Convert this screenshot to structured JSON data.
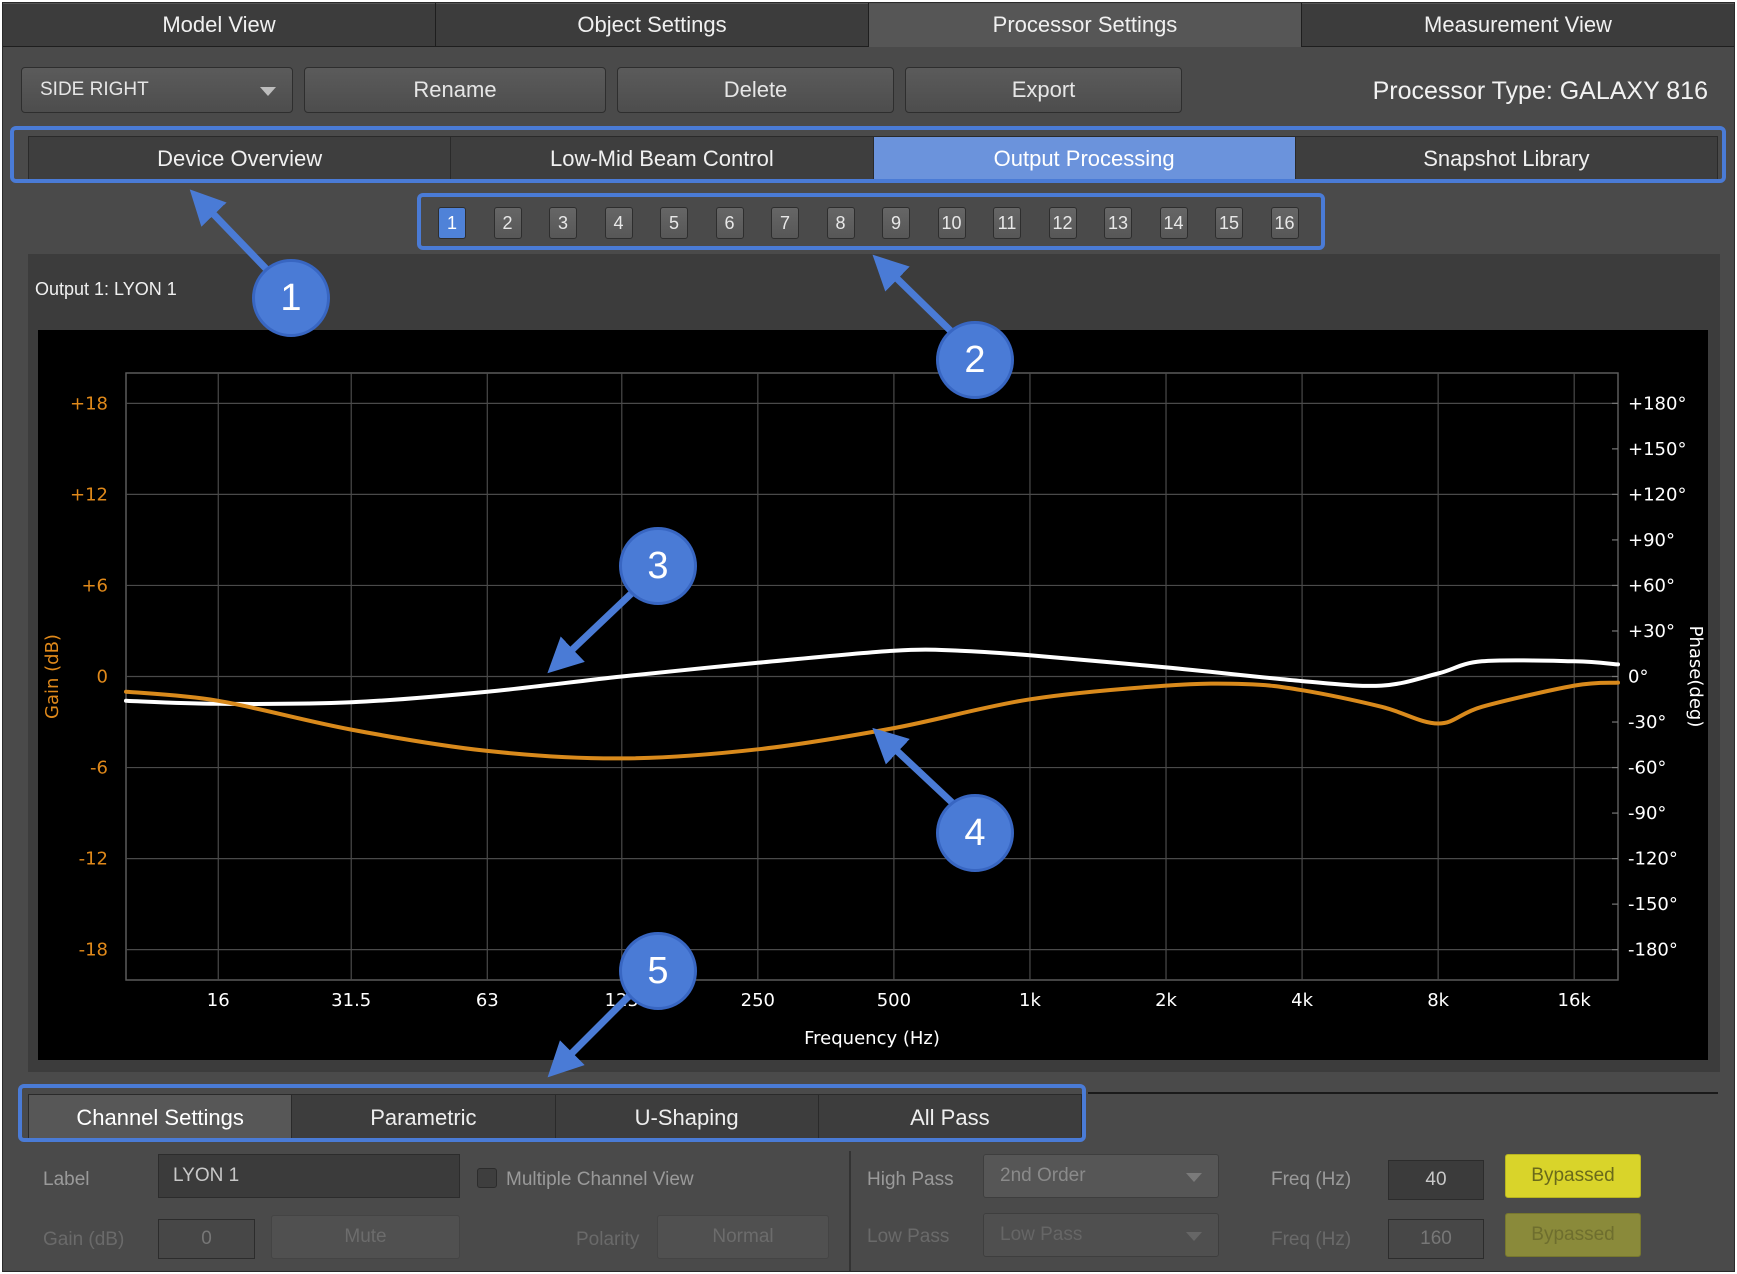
{
  "top_tabs": [
    {
      "label": "Model View",
      "active": false
    },
    {
      "label": "Object Settings",
      "active": false
    },
    {
      "label": "Processor Settings",
      "active": true
    },
    {
      "label": "Measurement View",
      "active": false
    }
  ],
  "toolbar": {
    "dropdown_value": "SIDE RIGHT",
    "rename_label": "Rename",
    "delete_label": "Delete",
    "export_label": "Export",
    "processor_type": "Processor Type: GALAXY 816"
  },
  "sub_tabs": [
    {
      "label": "Device Overview",
      "active": false
    },
    {
      "label": "Low-Mid Beam Control",
      "active": false
    },
    {
      "label": "Output Processing",
      "active": true
    },
    {
      "label": "Snapshot Library",
      "active": false
    }
  ],
  "channels": [
    "1",
    "2",
    "3",
    "4",
    "5",
    "6",
    "7",
    "8",
    "9",
    "10",
    "11",
    "12",
    "13",
    "14",
    "15",
    "16"
  ],
  "active_channel": "1",
  "output_label": "Output 1: LYON 1",
  "chart_data": {
    "type": "line",
    "xlabel": "Frequency (Hz)",
    "ylabel_left": "Gain (dB)",
    "ylabel_right": "Phase(deg)",
    "x_scale": "log",
    "x_ticks": [
      {
        "value": 16,
        "label": "16"
      },
      {
        "value": 31.5,
        "label": "31.5"
      },
      {
        "value": 63,
        "label": "63"
      },
      {
        "value": 125,
        "label": "125"
      },
      {
        "value": 250,
        "label": "250"
      },
      {
        "value": 500,
        "label": "500"
      },
      {
        "value": 1000,
        "label": "1k"
      },
      {
        "value": 2000,
        "label": "2k"
      },
      {
        "value": 4000,
        "label": "4k"
      },
      {
        "value": 8000,
        "label": "8k"
      },
      {
        "value": 16000,
        "label": "16k"
      }
    ],
    "xlim": [
      10,
      20000
    ],
    "gain_ticks": [
      {
        "value": 18,
        "label": "+18"
      },
      {
        "value": 12,
        "label": "+12"
      },
      {
        "value": 6,
        "label": "+6"
      },
      {
        "value": 0,
        "label": "0"
      },
      {
        "value": -6,
        "label": "-6"
      },
      {
        "value": -12,
        "label": "-12"
      },
      {
        "value": -18,
        "label": "-18"
      }
    ],
    "gain_lim": [
      -20,
      20
    ],
    "phase_ticks": [
      {
        "value": 180,
        "label": "+180°"
      },
      {
        "value": 150,
        "label": "+150°"
      },
      {
        "value": 120,
        "label": "+120°"
      },
      {
        "value": 90,
        "label": "+90°"
      },
      {
        "value": 60,
        "label": "+60°"
      },
      {
        "value": 30,
        "label": "+30°"
      },
      {
        "value": 0,
        "label": "0°"
      },
      {
        "value": -30,
        "label": "-30°"
      },
      {
        "value": -60,
        "label": "-60°"
      },
      {
        "value": -90,
        "label": "-90°"
      },
      {
        "value": -120,
        "label": "-120°"
      },
      {
        "value": -150,
        "label": "-150°"
      },
      {
        "value": -180,
        "label": "-180°"
      }
    ],
    "phase_lim": [
      -200,
      200
    ],
    "grid": true,
    "series": [
      {
        "color": "#ffffff",
        "axis": "phase",
        "x": [
          10,
          16,
          31.5,
          63,
          125,
          250,
          500,
          700,
          1000,
          2000,
          4000,
          6000,
          8000,
          10000,
          16000,
          20000
        ],
        "y": [
          -16,
          -18,
          -17,
          -10,
          0,
          9,
          17,
          17,
          14,
          6,
          -3,
          -6,
          2,
          10,
          10,
          8
        ]
      },
      {
        "color": "#d98a1c",
        "axis": "gain",
        "x": [
          10,
          16,
          31.5,
          63,
          125,
          250,
          500,
          1000,
          2000,
          3000,
          4000,
          6000,
          8000,
          10000,
          16000,
          20000
        ],
        "y": [
          -1.0,
          -1.6,
          -3.5,
          -4.9,
          -5.4,
          -4.8,
          -3.4,
          -1.5,
          -0.6,
          -0.5,
          -0.9,
          -2.0,
          -3.1,
          -2.0,
          -0.6,
          -0.4
        ]
      }
    ]
  },
  "bottom_tabs": [
    {
      "label": "Channel Settings",
      "active": true
    },
    {
      "label": "Parametric",
      "active": false
    },
    {
      "label": "U-Shaping",
      "active": false
    },
    {
      "label": "All Pass",
      "active": false
    }
  ],
  "settings": {
    "label_caption": "Label",
    "label_value": "LYON 1",
    "multi_channel_label": "Multiple Channel View",
    "gain_caption": "Gain (dB)",
    "gain_value": "0",
    "mute_label": "Mute",
    "polarity_caption": "Polarity",
    "polarity_value": "Normal",
    "high_pass_caption": "High Pass",
    "high_pass_value": "2nd Order",
    "high_freq_caption": "Freq (Hz)",
    "high_freq_value": "40",
    "high_bypass_label": "Bypassed",
    "low_pass_caption": "Low Pass",
    "low_pass_value": "Low Pass",
    "low_freq_caption": "Freq (Hz)",
    "low_freq_value": "160",
    "low_bypass_label": "Bypassed"
  },
  "callouts": [
    "1",
    "2",
    "3",
    "4",
    "5"
  ],
  "colors": {
    "accent": "#4a7bd6",
    "active_tab": "#6b93dc",
    "gain_axis": "#d98a1c",
    "bypass": "#d9d42a"
  }
}
